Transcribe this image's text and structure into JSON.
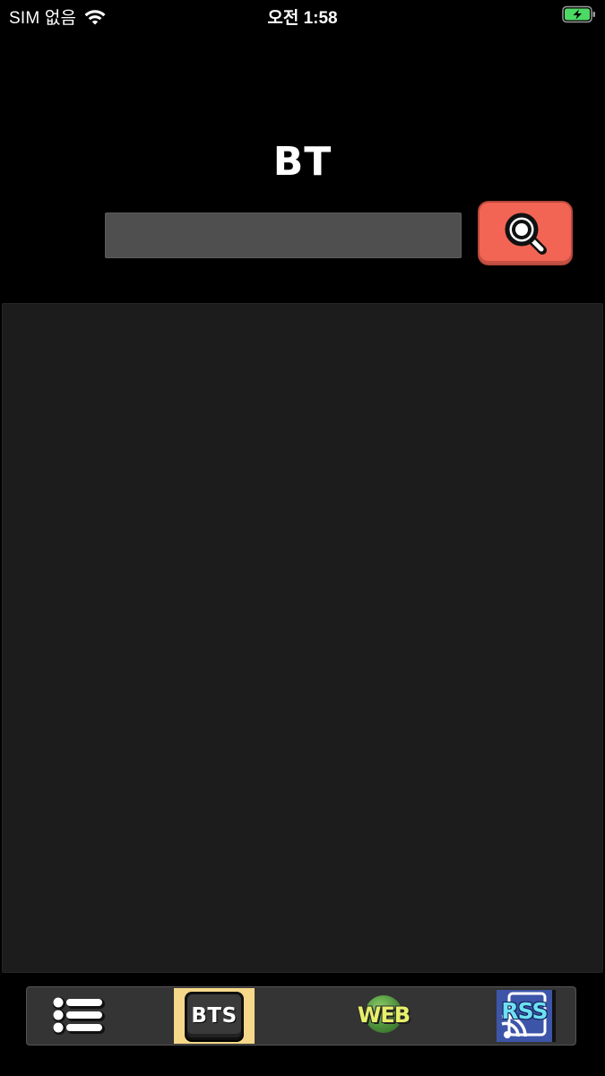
{
  "status_bar": {
    "carrier": "SIM 없음",
    "time": "오전 1:58",
    "battery_color": "#4cd964"
  },
  "header": {
    "title": "BT"
  },
  "search": {
    "value": "",
    "placeholder": "",
    "button_icon": "magnifier-icon",
    "button_color": "#f26454"
  },
  "content": {
    "panel_color": "#1c1c1c"
  },
  "tab_bar": {
    "tabs": [
      {
        "id": "menu",
        "icon": "list-icon",
        "label": ""
      },
      {
        "id": "bts",
        "icon": "bts-key-icon",
        "label": "BTS",
        "selected": true
      },
      {
        "id": "web",
        "icon": "web-globe-icon",
        "label": "WEB"
      },
      {
        "id": "rss",
        "icon": "rss-icon",
        "label": "RSS"
      }
    ],
    "selected_color": "#f5d889"
  }
}
